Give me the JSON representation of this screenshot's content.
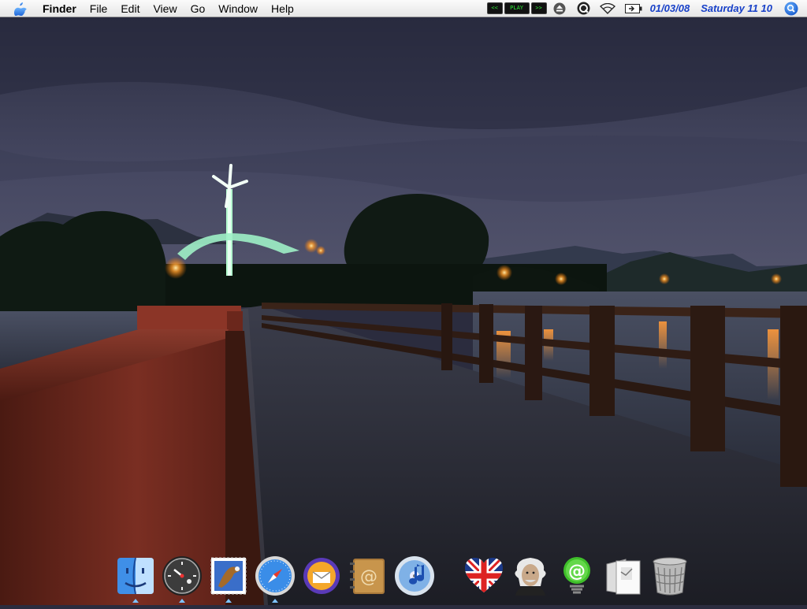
{
  "menubar": {
    "app_name": "Finder",
    "menus": [
      "File",
      "Edit",
      "View",
      "Go",
      "Window",
      "Help"
    ],
    "media_controls": {
      "prev": "<<",
      "play": "PLAY",
      "next": ">>"
    },
    "status_icons": [
      "eject-icon",
      "quicksilver-icon",
      "wifi-icon",
      "battery-icon"
    ],
    "clock_date": "01/03/08",
    "clock_time": "Saturday 11 10",
    "spotlight_icon": "spotlight-icon"
  },
  "desktop": {
    "wallpaper": "night-bridge-with-windmill"
  },
  "dock": {
    "items": [
      {
        "name": "Finder",
        "icon": "finder-icon",
        "running": true
      },
      {
        "name": "Dashboard",
        "icon": "dashboard-icon",
        "running": true
      },
      {
        "name": "Mail",
        "icon": "mail-icon",
        "running": true
      },
      {
        "name": "Safari",
        "icon": "safari-icon",
        "running": true
      },
      {
        "name": "Mail client",
        "icon": "mail-client-icon",
        "running": false
      },
      {
        "name": "Address Book",
        "icon": "address-book-icon",
        "running": false
      },
      {
        "name": "iTunes",
        "icon": "itunes-icon",
        "running": false
      },
      {
        "name": "UK flag",
        "icon": "uk-flag-heart-icon",
        "running": false
      },
      {
        "name": "Einstein",
        "icon": "einstein-icon",
        "running": false
      },
      {
        "name": "Email app",
        "icon": "at-sign-spring-icon",
        "running": false
      },
      {
        "name": "Documents",
        "icon": "documents-icon",
        "running": false
      },
      {
        "name": "Trash",
        "icon": "trash-icon",
        "running": false
      }
    ]
  },
  "colors": {
    "clock_text": "#1740c8",
    "media_text": "#2eea36",
    "dock_running_indicator": "#7ec3ff"
  }
}
